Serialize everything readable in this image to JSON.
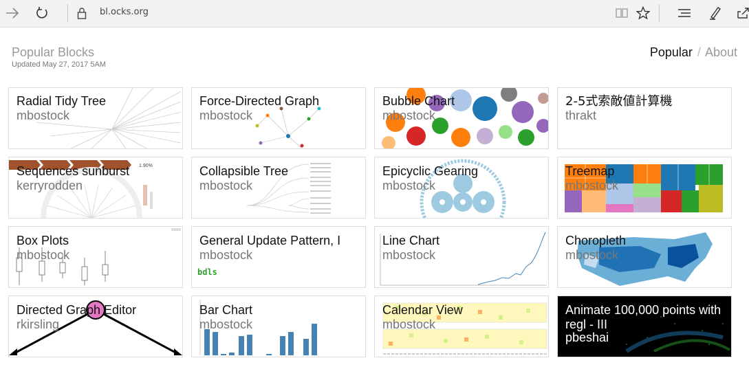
{
  "browser": {
    "url": "bl.ocks.org"
  },
  "header": {
    "title": "Popular Blocks",
    "updated": "Updated May 27, 2017 5AM",
    "nav": {
      "popular": "Popular",
      "separator": "/",
      "about": "About"
    }
  },
  "blocks": [
    {
      "title": "Radial Tidy Tree",
      "owner": "mbostock"
    },
    {
      "title": "Force-Directed Graph",
      "owner": "mbostock"
    },
    {
      "title": "Bubble Chart",
      "owner": "mbostock"
    },
    {
      "title": "2-5式索敵値計算機",
      "owner": "thrakt"
    },
    {
      "title": "Sequences sunburst",
      "owner": "kerryrodden",
      "thumb_text": "1.90%"
    },
    {
      "title": "Collapsible Tree",
      "owner": "mbostock"
    },
    {
      "title": "Epicyclic Gearing",
      "owner": "mbostock"
    },
    {
      "title": "Treemap",
      "owner": "mbostock"
    },
    {
      "title": "Box Plots",
      "owner": "mbostock"
    },
    {
      "title": "General Update Pattern, I",
      "owner": "mbostock",
      "thumb_text": "bdls"
    },
    {
      "title": "Line Chart",
      "owner": "mbostock"
    },
    {
      "title": "Choropleth",
      "owner": "mbostock"
    },
    {
      "title": "Directed Graph Editor",
      "owner": "rkirsling"
    },
    {
      "title": "Bar Chart",
      "owner": "mbostock"
    },
    {
      "title": "Calendar View",
      "owner": "mbostock"
    },
    {
      "title": "Animate 100,000 points with regl - III",
      "owner": "pbeshai"
    }
  ],
  "colors": {
    "accent_blue": "#4682b4",
    "link_gray": "#999999"
  }
}
